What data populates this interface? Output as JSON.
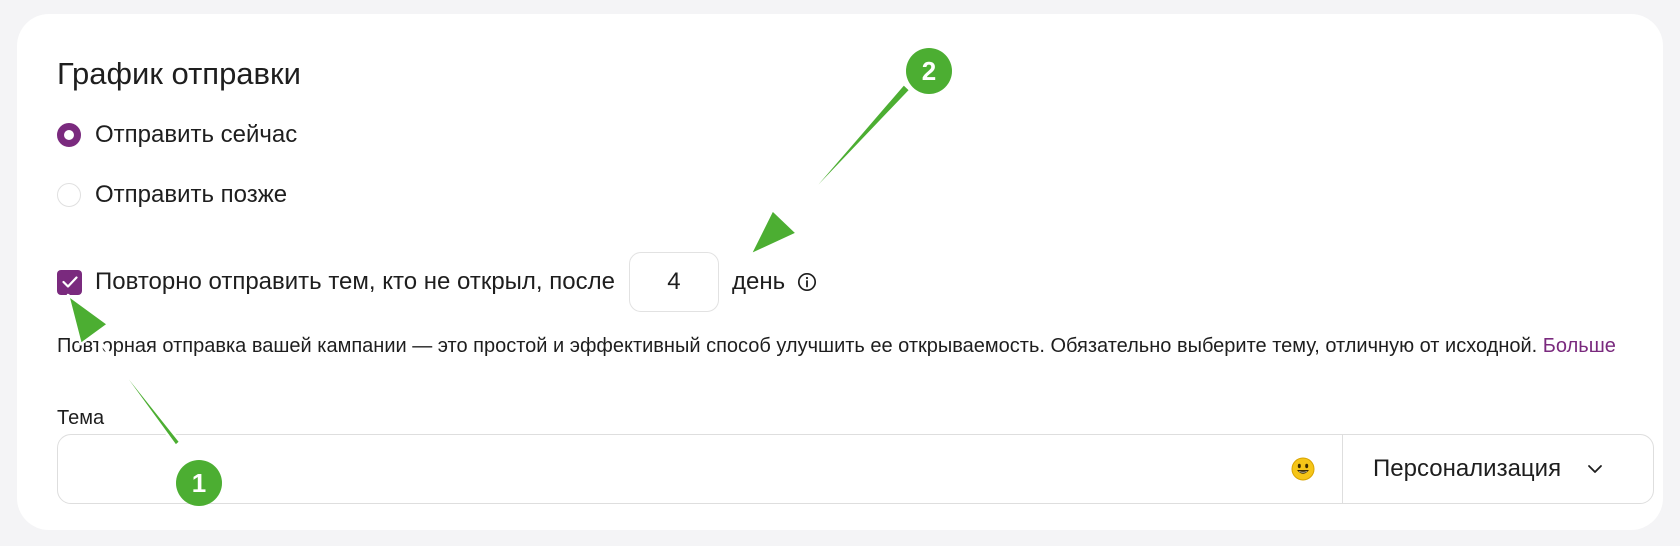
{
  "schedule": {
    "title": "График отправки",
    "options": [
      {
        "label": "Отправить сейчас",
        "selected": true
      },
      {
        "label": "Отправить позже",
        "selected": false
      }
    ],
    "resend": {
      "checked": true,
      "label": "Повторно отправить тем, кто не открыл, после",
      "days_value": "4",
      "days_unit": "день",
      "info_icon": "info-icon"
    },
    "description": "Повторная отправка вашей кампании — это простой и эффективный способ улучшить ее открываемость. Обязательно выберите тему, отличную от исходной.",
    "more_link": "Больше",
    "subject": {
      "label": "Тема",
      "value": "",
      "emoji_icon": "smiley-emoji-icon",
      "personalize_label": "Персонализация"
    }
  },
  "annotations": {
    "badge_1": "1",
    "badge_2": "2",
    "accent_color": "#4cae32"
  },
  "colors": {
    "brand_purple": "#7a2a7e",
    "annotation_green": "#4cae32"
  }
}
